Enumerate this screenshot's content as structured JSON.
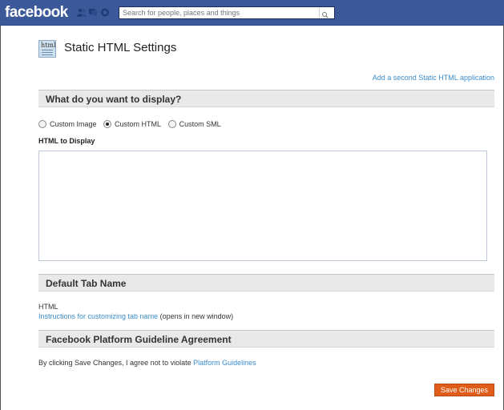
{
  "header": {
    "logo_text": "facebook",
    "search_placeholder": "Search for people, places and things",
    "icons": [
      "friend-requests-icon",
      "messages-icon",
      "notifications-icon",
      "search-icon"
    ]
  },
  "page": {
    "title": "Static HTML Settings",
    "add_link": "Add a second Static HTML application"
  },
  "display_section": {
    "heading": "What do you want to display?",
    "options": [
      "Custom Image",
      "Custom HTML",
      "Custom SML"
    ],
    "selected": "Custom HTML",
    "html_label": "HTML to Display",
    "html_value": ""
  },
  "tab_section": {
    "heading": "Default Tab Name",
    "tab_name": "HTML",
    "instructions_link": "Instructions for customizing tab name",
    "instructions_suffix": " (opens in new window)"
  },
  "agreement_section": {
    "heading": "Facebook Platform Guideline Agreement",
    "text": "By clicking Save Changes, I agree not to violate ",
    "link": "Platform Guidelines"
  },
  "actions": {
    "save_label": "Save Changes"
  },
  "colors": {
    "header_bg": "#3b5998",
    "link": "#3b8ccb",
    "save_bg": "#e05c19",
    "section_bg": "#e9e9e9"
  }
}
